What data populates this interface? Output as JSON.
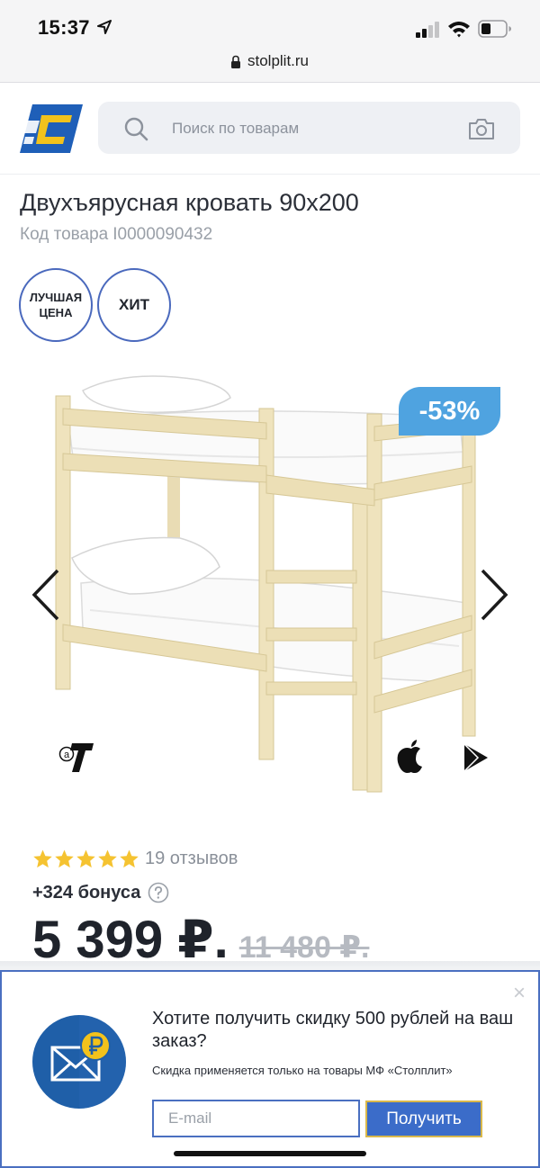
{
  "status_bar": {
    "time": "15:37"
  },
  "browser": {
    "url": "stolplit.ru"
  },
  "header": {
    "search_placeholder": "Поиск по товарам"
  },
  "product": {
    "title": "Двухъярусная кровать 90x200",
    "code_label": "Код товара",
    "code_value": "I0000090432",
    "badges": [
      {
        "label": "ЛУЧШАЯ ЦЕНА"
      },
      {
        "label": "ХИТ"
      }
    ],
    "discount": "-53%",
    "rating": 5,
    "reviews": "19 отзывов",
    "bonus": "+324 бонуса",
    "price": "5 399 ₽.",
    "old_price": "11 480 ₽."
  },
  "popup": {
    "title": "Хотите получить скидку 500 рублей на ваш заказ?",
    "note": "Скидка применяется только на товары МФ «Столплит»",
    "email_placeholder": "E-mail",
    "submit_label": "Получить",
    "close_label": "×"
  },
  "colors": {
    "accent": "#4a6fc0",
    "discount_badge": "#4fa3e0",
    "star": "#f5c331",
    "submit_button": "#3b6cc9"
  }
}
